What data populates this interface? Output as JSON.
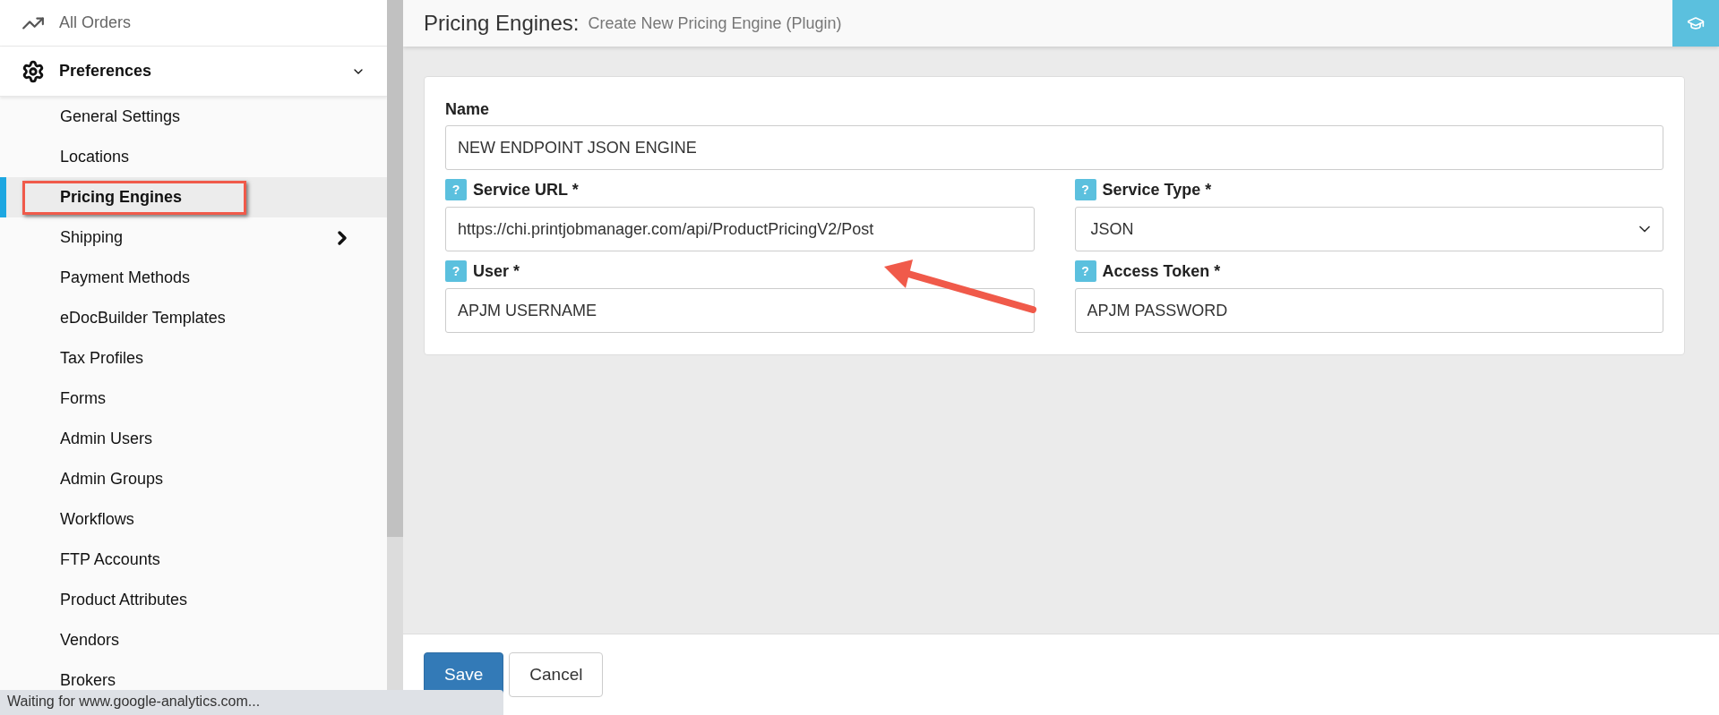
{
  "sidebar": {
    "top_items": [
      {
        "label": "All Orders",
        "kind": "chart",
        "bold": false
      },
      {
        "label": "Preferences",
        "kind": "gears",
        "bold": true,
        "expanded": true
      }
    ],
    "items": [
      {
        "label": "General Settings",
        "selected": false,
        "expandable": false
      },
      {
        "label": "Locations",
        "selected": false,
        "expandable": false
      },
      {
        "label": "Pricing Engines",
        "selected": true,
        "expandable": false,
        "highlighted": true
      },
      {
        "label": "Shipping",
        "selected": false,
        "expandable": true
      },
      {
        "label": "Payment Methods",
        "selected": false,
        "expandable": false
      },
      {
        "label": "eDocBuilder Templates",
        "selected": false,
        "expandable": false
      },
      {
        "label": "Tax Profiles",
        "selected": false,
        "expandable": false
      },
      {
        "label": "Forms",
        "selected": false,
        "expandable": false
      },
      {
        "label": "Admin Users",
        "selected": false,
        "expandable": false
      },
      {
        "label": "Admin Groups",
        "selected": false,
        "expandable": false
      },
      {
        "label": "Workflows",
        "selected": false,
        "expandable": false
      },
      {
        "label": "FTP Accounts",
        "selected": false,
        "expandable": false
      },
      {
        "label": "Product Attributes",
        "selected": false,
        "expandable": false
      },
      {
        "label": "Vendors",
        "selected": false,
        "expandable": false
      },
      {
        "label": "Brokers",
        "selected": false,
        "expandable": false
      }
    ]
  },
  "header": {
    "title": "Pricing Engines:",
    "subtitle": "Create New Pricing Engine (Plugin)"
  },
  "form": {
    "name": {
      "label": "Name",
      "value": "NEW ENDPOINT JSON ENGINE"
    },
    "fields": [
      {
        "label": "Service URL *",
        "value": "https://chi.printjobmanager.com/api/ProductPricingV2/Post",
        "kind": "text",
        "help": "?"
      },
      {
        "label": "Service Type *",
        "value": "JSON",
        "kind": "select",
        "help": "?"
      },
      {
        "label": "User *",
        "value": "APJM USERNAME",
        "kind": "text",
        "help": "?"
      },
      {
        "label": "Access Token *",
        "value": "APJM PASSWORD",
        "kind": "text",
        "help": "?"
      }
    ]
  },
  "buttons": [
    {
      "label": "Save",
      "kind": "primary"
    },
    {
      "label": "Cancel",
      "kind": "default"
    }
  ],
  "status_bar": "Waiting for www.google-analytics.com..."
}
